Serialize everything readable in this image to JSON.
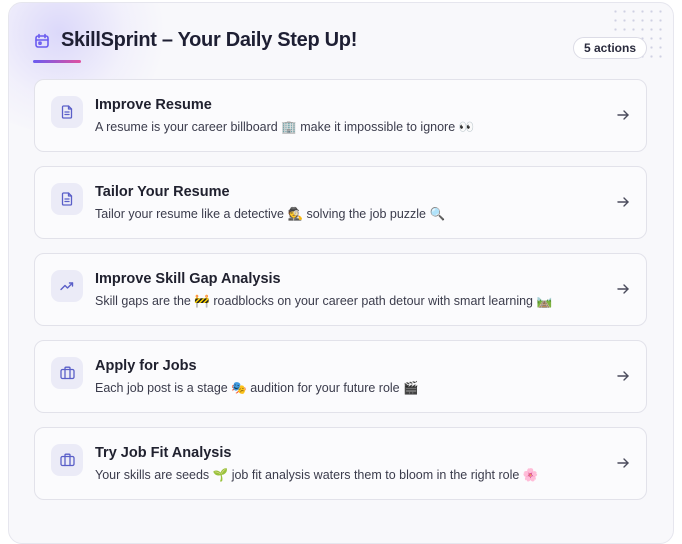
{
  "header": {
    "title": "SkillSprint – Your Daily Step Up!",
    "badge": "5 actions",
    "icon": "calendar-icon"
  },
  "colors": {
    "accent": "#6b5cf0",
    "accent_pink": "#e0509f",
    "icon_bg": "#ebebf7"
  },
  "cards": [
    {
      "title": "Improve Resume",
      "description": "A resume is your career billboard 🏢 make it impossible to ignore 👀",
      "icon": "document-icon"
    },
    {
      "title": "Tailor Your Resume",
      "description": "Tailor your resume like a detective 🕵️ solving the job puzzle 🔍",
      "icon": "document-icon"
    },
    {
      "title": "Improve Skill Gap Analysis",
      "description": "Skill gaps are the 🚧 roadblocks on your career path detour with smart learning 🛤️",
      "icon": "trending-up-icon"
    },
    {
      "title": "Apply for Jobs",
      "description": "Each job post is a stage 🎭 audition for your future role 🎬",
      "icon": "briefcase-icon"
    },
    {
      "title": "Try Job Fit Analysis",
      "description": "Your skills are seeds 🌱 job fit analysis waters them to bloom in the right role 🌸",
      "icon": "briefcase-icon"
    }
  ]
}
